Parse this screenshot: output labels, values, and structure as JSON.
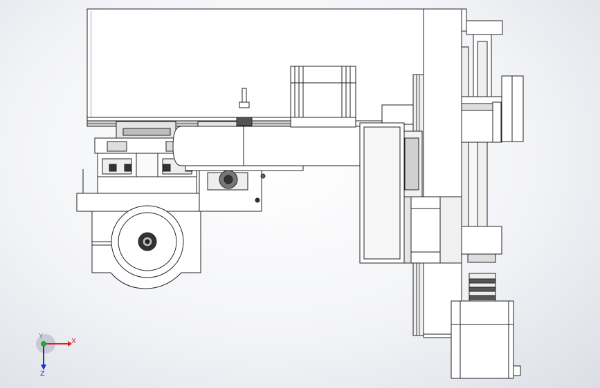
{
  "triad": {
    "x_label": "X",
    "y_label": "Y",
    "z_label": "Z",
    "colors": {
      "x": "#e02020",
      "y": "#1faa2a",
      "z": "#1a2fd6"
    }
  },
  "style": {
    "line": "#222222",
    "part_fill": "#ffffff",
    "shade": "#c8c8c8",
    "dark": "#5a5a5a"
  }
}
